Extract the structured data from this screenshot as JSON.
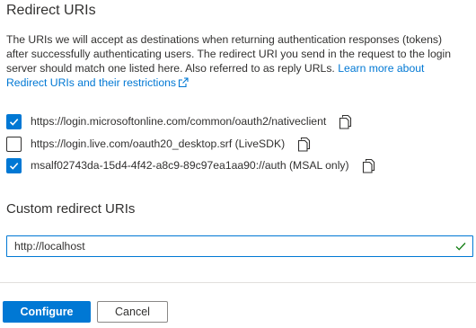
{
  "section": {
    "title": "Redirect URIs",
    "description": "The URIs we will accept as destinations when returning authentication responses (tokens) after successfully authenticating users. The redirect URI you send in the request to the login server should match one listed here. Also referred to as reply URLs.",
    "learn_more_link": "Learn more about Redirect URIs and their restrictions"
  },
  "redirect_uris": [
    {
      "checked": true,
      "uri": "https://login.microsoftonline.com/common/oauth2/nativeclient"
    },
    {
      "checked": false,
      "uri": "https://login.live.com/oauth20_desktop.srf (LiveSDK)"
    },
    {
      "checked": true,
      "uri": "msalf02743da-15d4-4f42-a8c9-89c97ea1aa90://auth (MSAL only)"
    }
  ],
  "custom": {
    "title": "Custom redirect URIs",
    "value": "http://localhost",
    "placeholder": ""
  },
  "buttons": {
    "configure_label": "Configure",
    "cancel_label": "Cancel"
  },
  "colors": {
    "accent": "#0078d4",
    "valid_check": "#107c10",
    "text": "#323130"
  }
}
